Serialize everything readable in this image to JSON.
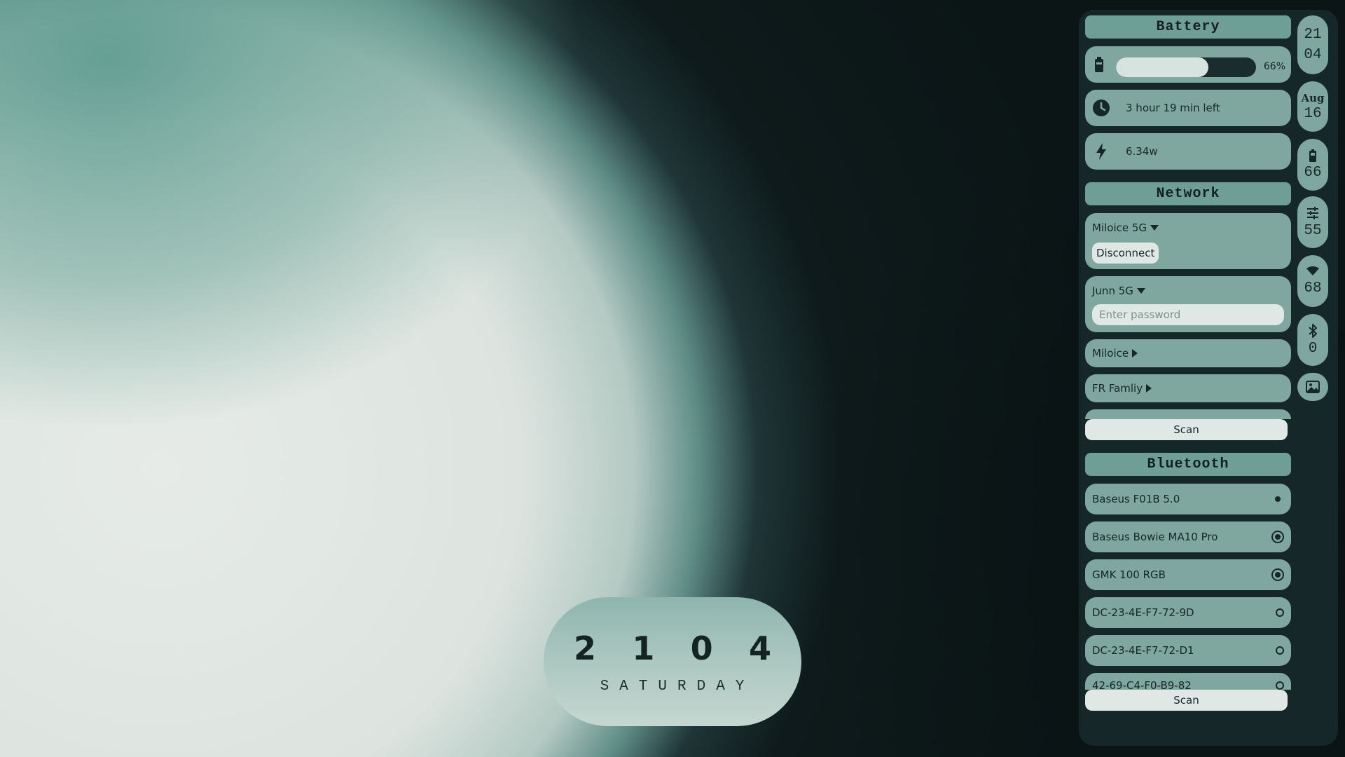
{
  "clock": {
    "digits": [
      "2",
      "1",
      "0",
      "4"
    ],
    "day": "SATURDAY"
  },
  "battery": {
    "header": "Battery",
    "level_percent": 66,
    "level_label": "66%",
    "time_left": "3 hour 19 min left",
    "power": "6.34w"
  },
  "network": {
    "header": "Network",
    "networks": [
      {
        "name": "Miloice 5G",
        "expanded": true,
        "action_label": "Disconnect"
      },
      {
        "name": "Junn 5G",
        "expanded": true,
        "password_placeholder": "Enter password"
      },
      {
        "name": "Miloice",
        "expanded": false
      },
      {
        "name": "FR Famliy",
        "expanded": false
      }
    ],
    "scan_label": "Scan"
  },
  "bluetooth": {
    "header": "Bluetooth",
    "devices": [
      {
        "name": "Baseus F01B 5.0",
        "state": "connected"
      },
      {
        "name": "Baseus Bowie MA10 Pro",
        "state": "paired"
      },
      {
        "name": "GMK 100 RGB",
        "state": "paired"
      },
      {
        "name": "DC-23-4E-F7-72-9D",
        "state": "available"
      },
      {
        "name": "DC-23-4E-F7-72-D1",
        "state": "available"
      },
      {
        "name": "42-69-C4-F0-B9-82",
        "state": "available"
      }
    ],
    "scan_label": "Scan"
  },
  "strip": {
    "time_hour": "21",
    "time_minute": "04",
    "month": "Aug",
    "day": "16",
    "battery": "66",
    "volume": "55",
    "wifi": "68",
    "bluetooth": "0"
  },
  "colors": {
    "panel_bg": "#16272a",
    "card_bg": "#7fa69f",
    "header_bg": "#6f9e96",
    "light": "#dfe8e4"
  }
}
